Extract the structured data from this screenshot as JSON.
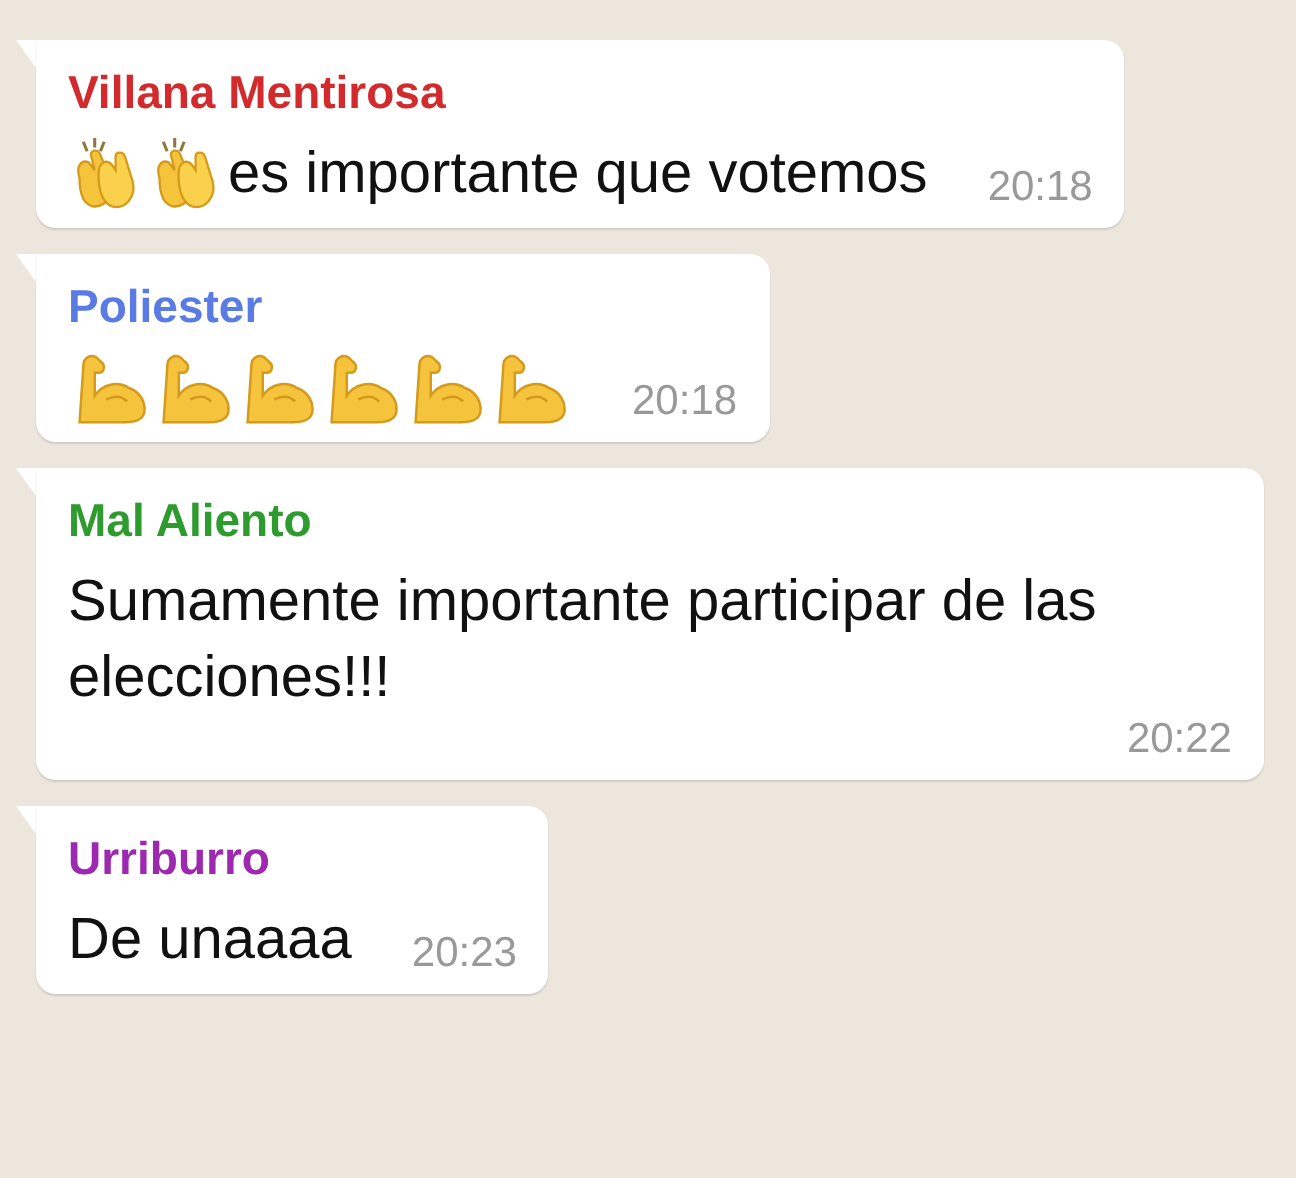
{
  "messages": [
    {
      "sender": "Villana Mentirosa",
      "color": "#d32a2e",
      "content": [
        {
          "kind": "clap"
        },
        {
          "kind": "clap"
        },
        {
          "kind": "text",
          "text": "es importante que votemos"
        }
      ],
      "time": "20:18"
    },
    {
      "sender": "Poliester",
      "color": "#5a7be3",
      "content": [
        {
          "kind": "flex"
        },
        {
          "kind": "flex"
        },
        {
          "kind": "flex"
        },
        {
          "kind": "flex"
        },
        {
          "kind": "flex"
        },
        {
          "kind": "flex"
        }
      ],
      "time": "20:18"
    },
    {
      "sender": "Mal Aliento",
      "color": "#2e9b2e",
      "content": [
        {
          "kind": "text",
          "text": "Sumamente importante participar de las elecciones!!!"
        }
      ],
      "time": "20:22"
    },
    {
      "sender": "Urriburro",
      "color": "#9c29b0",
      "content": [
        {
          "kind": "text",
          "text": "De unaaaa"
        }
      ],
      "time": "20:23"
    }
  ]
}
